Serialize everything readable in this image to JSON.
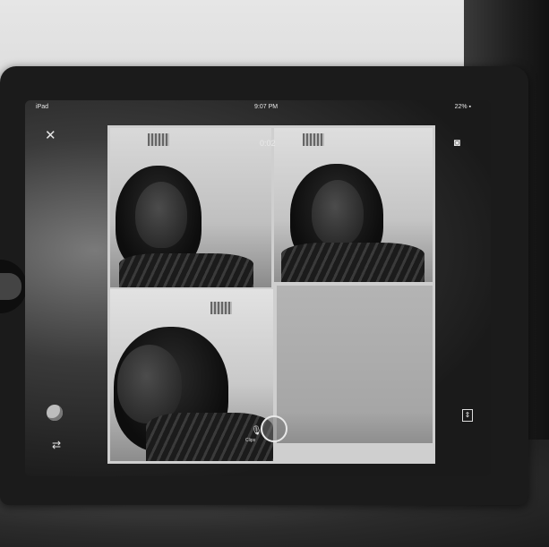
{
  "status_bar": {
    "device": "iPad",
    "time": "9:07 PM",
    "battery": "22% ▪"
  },
  "call": {
    "timer": "0:02"
  },
  "toolbar": {
    "close_icon": "close-icon",
    "camera_icon": "camera-icon",
    "pen_icon": "pen-icon",
    "flip_icon": "flip-icon",
    "layout_icon": "layout-icon",
    "mic_icon": "mic-icon",
    "mic_label": "Clips"
  }
}
